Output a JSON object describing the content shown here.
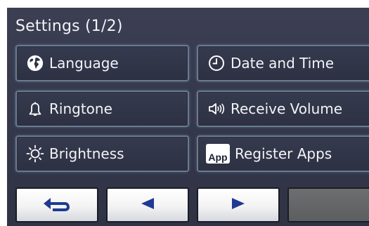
{
  "header": {
    "title": "Settings (1/2)"
  },
  "tiles": [
    {
      "label": "Language",
      "icon": "globe-icon"
    },
    {
      "label": "Date and Time",
      "icon": "clock-icon"
    },
    {
      "label": "Ringtone",
      "icon": "bell-icon"
    },
    {
      "label": "Receive Volume",
      "icon": "speaker-volume-icon"
    },
    {
      "label": "Brightness",
      "icon": "sun-icon"
    },
    {
      "label": "Register Apps",
      "icon": "app-icon",
      "icon_text": "App"
    }
  ],
  "nav": {
    "back_icon": "return-arrow-icon",
    "prev_icon": "left-triangle-icon",
    "next_icon": "right-triangle-icon"
  },
  "colors": {
    "background": "#34374a",
    "tile_border": "#6c7a8c",
    "text": "#f3f4f8",
    "nav_button": "#f3f3f3",
    "nav_disabled": "#5c5e60"
  }
}
